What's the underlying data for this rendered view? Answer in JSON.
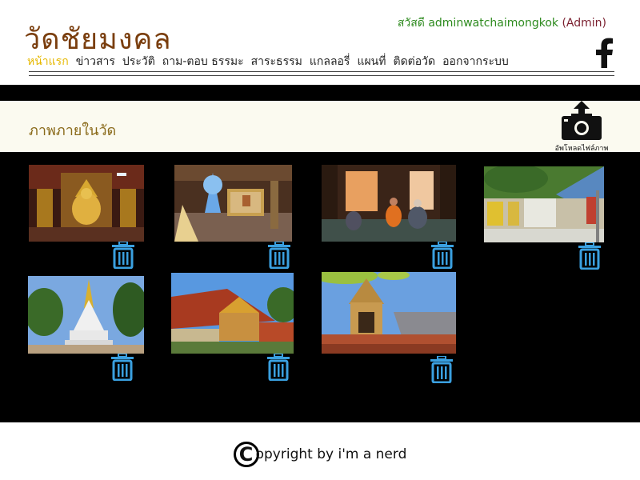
{
  "header": {
    "site_title": "วัดชัยมงคล",
    "greeting_prefix": "สวัสดี",
    "username": "adminwatchaimongkok",
    "role": "(Admin)"
  },
  "nav": {
    "items": [
      {
        "label": "หน้าแรก",
        "active": true
      },
      {
        "label": "ข่าวสาร",
        "active": false
      },
      {
        "label": "ประวัติ",
        "active": false
      },
      {
        "label": "ถาม-ตอบ ธรรมะ",
        "active": false
      },
      {
        "label": "สาระธรรม",
        "active": false
      },
      {
        "label": "แกลลอรี่",
        "active": false
      },
      {
        "label": "แผนที่",
        "active": false
      },
      {
        "label": "ติดต่อวัด",
        "active": false
      },
      {
        "label": "ออกจากระบบ",
        "active": false
      }
    ]
  },
  "section": {
    "title": "ภาพภายในวัด",
    "upload_label": "อัพโหลดไฟล์ภาพ"
  },
  "gallery": {
    "photos": [
      {
        "subject": "temple-interior-buddha"
      },
      {
        "subject": "altar-with-flowers"
      },
      {
        "subject": "monks-in-hall"
      },
      {
        "subject": "temple-courtyard"
      },
      {
        "subject": "white-stupa"
      },
      {
        "subject": "temple-roof"
      },
      {
        "subject": "bell-tower"
      }
    ]
  },
  "footer": {
    "copyright_symbol": "C",
    "copyright_text": "opyright by i'm a nerd"
  },
  "colors": {
    "title": "#7a3e0e",
    "nav_active": "#e6b800",
    "greeting": "#2e8b1f",
    "trash_icon": "#3aa0e0"
  }
}
